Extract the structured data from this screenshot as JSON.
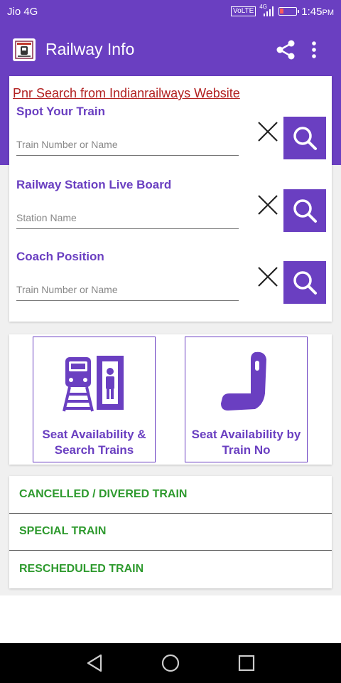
{
  "status_bar": {
    "carrier": "Jio 4G",
    "volte": "VoLTE",
    "network": "4G",
    "time": "1:45",
    "ampm": "PM"
  },
  "app_bar": {
    "title": "Railway Info",
    "logo_icon": "railway-logo-icon",
    "share_icon": "share-icon",
    "menu_icon": "more-vert-icon"
  },
  "search_card": {
    "pnr_link": "Pnr Search from Indianrailways Website",
    "sections": [
      {
        "title": "Spot Your Train",
        "placeholder": "Train Number or Name"
      },
      {
        "title": "Railway Station Live Board",
        "placeholder": "Station Name"
      },
      {
        "title": "Coach Position",
        "placeholder": "Train Number or Name"
      }
    ]
  },
  "tiles": [
    {
      "label": "Seat Availability & Search Trains",
      "icon": "train-station-icon"
    },
    {
      "label": "Seat Availability by Train No",
      "icon": "train-seat-icon"
    }
  ],
  "list": [
    {
      "label": "CANCELLED / DIVERED TRAIN"
    },
    {
      "label": "SPECIAL TRAIN"
    },
    {
      "label": "RESCHEDULED TRAIN"
    }
  ],
  "colors": {
    "primary": "#6a3fc1",
    "link_red": "#b22020",
    "list_green": "#2e9a2e"
  }
}
